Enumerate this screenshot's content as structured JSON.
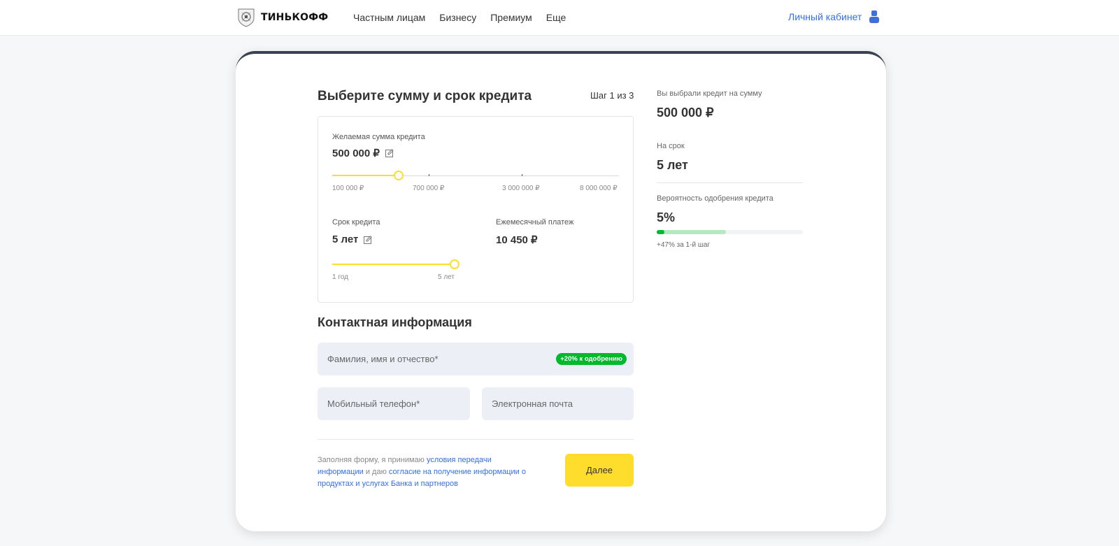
{
  "header": {
    "brand": "ТИНЬКОФФ",
    "nav": [
      "Частным лицам",
      "Бизнесу",
      "Премиум",
      "Еще"
    ],
    "account_label": "Личный кабинет"
  },
  "form": {
    "title": "Выберите сумму и срок кредита",
    "step": "Шаг 1 из 3",
    "amount": {
      "label": "Желаемая сумма кредита",
      "value": "500 000 ₽",
      "slider_ticks": [
        "100 000 ₽",
        "700 000 ₽",
        "3 000 000 ₽",
        "8 000 000 ₽"
      ],
      "slider_position_pct": 23
    },
    "term": {
      "label": "Срок кредита",
      "value": "5 лет",
      "slider_ticks": [
        "1 год",
        "5 лет"
      ],
      "slider_position_pct": 100
    },
    "payment": {
      "label": "Ежемесячный платеж",
      "value": "10 450 ₽"
    }
  },
  "contact": {
    "title": "Контактная информация",
    "fio_placeholder": "Фамилия, имя и отчество*",
    "fio_badge": "+20% к одобрению",
    "phone_placeholder": "Мобильный телефон*",
    "email_placeholder": "Электронная почта"
  },
  "consent": {
    "text1": "Заполняя форму, я принимаю ",
    "link1": "условия передачи информации",
    "text2": " и даю ",
    "link2": "согласие на получение информации о продуктах и услугах Банка и партнеров"
  },
  "next_button": "Далее",
  "summary": {
    "amount_label": "Вы выбрали кредит на сумму",
    "amount_value": "500 000 ₽",
    "term_label": "На срок",
    "term_value": "5 лет",
    "probability_label": "Вероятность одобрения кредита",
    "probability_value": "5%",
    "probability_pct": 5,
    "potential_pct": 47,
    "probability_note": "+47% за 1-й шаг"
  },
  "colors": {
    "accent_yellow": "#ffdd2d",
    "link_blue": "#336fee",
    "success_green": "#00b92d"
  }
}
